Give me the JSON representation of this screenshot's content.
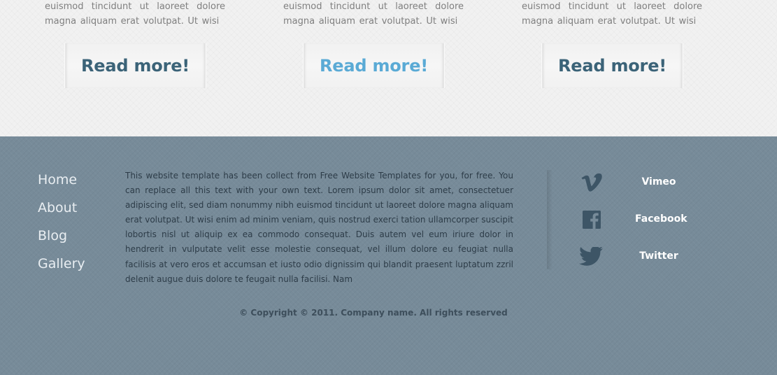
{
  "columns": [
    {
      "text": "euismod tincidunt ut laoreet dolore magna aliquam erat volutpat. Ut wisi",
      "read_more": "Read more!"
    },
    {
      "text": "euismod tincidunt ut laoreet dolore magna aliquam erat volutpat. Ut wisi",
      "read_more": "Read more!"
    },
    {
      "text": "euismod tincidunt ut laoreet dolore magna aliquam erat volutpat. Ut wisi",
      "read_more": "Read more!"
    }
  ],
  "footer": {
    "nav": [
      "Home",
      "About",
      "Blog",
      "Gallery"
    ],
    "about_text": "This website template has been collect from Free Website Templates for you, for free. You can replace all this text with your own text. Lorem ipsum dolor sit amet, consectetuer adipiscing elit, sed diam nonummy nibh euismod tincidunt ut laoreet dolore magna aliquam erat volutpat. Ut wisi enim ad minim veniam, quis nostrud exerci tation ullamcorper suscipit lobortis nisl ut aliquip ex ea commodo consequat. Duis autem vel eum iriure dolor in hendrerit in vulputate velit esse molestie consequat, vel illum dolore eu feugiat nulla facilisis at vero eros et accumsan et iusto odio dignissim qui blandit praesent luptatum zzril delenit augue duis dolore te feugait nulla facilisi. Nam",
    "social": [
      {
        "icon": "vimeo-icon",
        "label": "Vimeo"
      },
      {
        "icon": "facebook-icon",
        "label": "Facebook"
      },
      {
        "icon": "twitter-icon",
        "label": "Twitter"
      }
    ],
    "copyright": "© Copyright © 2011. Company name. All rights reserved"
  },
  "colors": {
    "page_bg": "#f1f1f1",
    "read_more": "#3b6378",
    "read_more_active": "#5aaad5",
    "footer_bg": "#778b99",
    "footer_text": "#2d3c48",
    "nav_link": "#e9eef2",
    "social_icon": "#3d5566"
  }
}
